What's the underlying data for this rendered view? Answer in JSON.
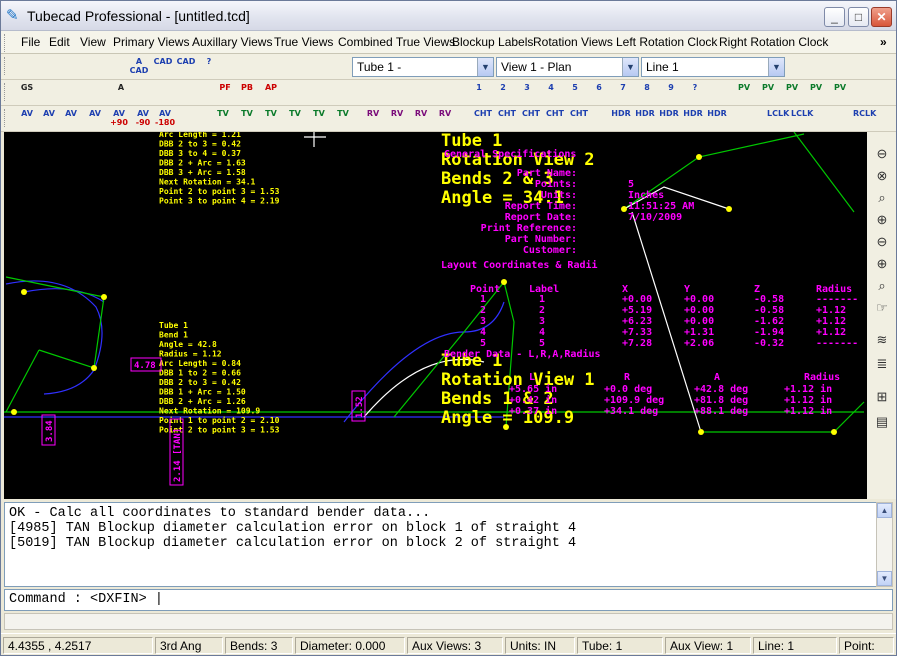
{
  "window": {
    "title": "Tubecad Professional  - [untitled.tcd]",
    "min": "_",
    "max": "□",
    "close": "✕"
  },
  "menu": [
    "File",
    "Edit",
    "View",
    "Primary Views",
    "Auxillary Views",
    "True Views",
    "Combined True Views",
    "Blockup Labels",
    "Rotation Views",
    "Left Rotation Clock",
    "Right Rotation Clock"
  ],
  "menu_more": "»",
  "toolbar1": {
    "combos": {
      "tube": "Tube 1 -",
      "view": "View 1 - Plan",
      "line": "Line 1"
    },
    "icons": [
      "new-file-icon",
      "new-icon",
      "open-icon",
      "save-icon",
      "print-icon",
      "cad-a-icon",
      "cad-icon",
      "cad-b-icon",
      "help-icon",
      "zoom-page-icon",
      "zoom-page-2-icon",
      "zoom-page-3-icon",
      "zoom-page-4-icon",
      "zoom-page-5-icon",
      "zoom-page-6-icon"
    ],
    "icon_labels": [
      "",
      "",
      "",
      "",
      "",
      "A CAD",
      "CAD",
      "CAD",
      "?",
      "",
      "",
      "",
      "",
      "",
      ""
    ]
  },
  "toolbar2": {
    "labels": [
      "GS",
      "",
      "",
      "",
      "A",
      "",
      "",
      "",
      "PF",
      "PB",
      "AP",
      "",
      "",
      "",
      "",
      "",
      "",
      "",
      "1",
      "2",
      "3",
      "4",
      "5",
      "6",
      "7",
      "8",
      "9",
      "?",
      "PV",
      "PV",
      "PV",
      "PV",
      "PV"
    ]
  },
  "toolbar3": {
    "labels": [
      "AV",
      "AV",
      "AV",
      "AV",
      "AV",
      "AV",
      "AV",
      "TV",
      "TV",
      "TV",
      "TV",
      "TV",
      "TV",
      "RV",
      "RV",
      "RV",
      "RV",
      "CHT",
      "CHT",
      "CHT",
      "CHT",
      "CHT",
      "HDR",
      "HDR",
      "HDR",
      "HDR",
      "HDR",
      "LCLK",
      "LCLK",
      "RCLK"
    ],
    "sub": [
      "",
      "",
      "",
      "",
      "+90",
      "-90",
      "-180",
      "",
      "",
      "",
      "",
      "",
      "",
      "",
      "",
      "",
      "",
      "",
      "",
      "",
      "",
      "",
      "",
      "",
      "",
      "",
      "",
      "",
      "",
      ""
    ]
  },
  "canvas": {
    "yellow_block_top": [
      "Arc Length = 1.21",
      "DBB 2 to 3 = 0.42",
      "DBB 3 to 4 = 0.37",
      "DBB 2 + Arc = 1.63",
      "DBB 3 + Arc = 1.58",
      "Next Rotation = 34.1",
      "Point 2 to point 3 = 1.53",
      "Point 3 to point 4 = 2.19"
    ],
    "yellow_block_mid": [
      "Tube 1",
      "Bend 1",
      "Angle = 42.8",
      "Radius = 1.12",
      "Arc Length = 0.84",
      "DBB 1 to 2 = 0.66",
      "DBB 2 to 3 = 0.42",
      "DBB 1 + Arc = 1.50",
      "DBB 2 + Arc = 1.26",
      "Next Rotation = 109.9",
      "Point 1 to point 2 = 2.10",
      "Point 2 to point 3 = 1.53"
    ],
    "view2_header": [
      "Tube 1",
      "Rotation View 2",
      "Bends 2 & 3",
      "Angle = 34.1"
    ],
    "view1_header": [
      "Tube 1",
      "Rotation View 1",
      "Bends 1 & 2",
      "Angle = 109.9"
    ],
    "spec": {
      "title": "General Specifications",
      "rows": [
        [
          "Part Name:",
          ""
        ],
        [
          "Points:",
          "5"
        ],
        [
          "Units:",
          "Inches"
        ],
        [
          "Report Time:",
          "11:51:25 AM"
        ],
        [
          "Report Date:",
          "7/10/2009"
        ],
        [
          "Print Reference:",
          ""
        ],
        [
          "Part Number:",
          ""
        ],
        [
          "Customer:",
          ""
        ]
      ],
      "footer": "Layout Coordinates & Radii"
    },
    "coord_header": [
      "Point",
      "Label",
      "X",
      "Y",
      "Z",
      "Radius"
    ],
    "coords": [
      [
        "1",
        "1",
        "+0.00",
        "+0.00",
        "-0.58",
        "-------"
      ],
      [
        "2",
        "2",
        "+5.19",
        "+0.00",
        "-0.58",
        "+1.12"
      ],
      [
        "3",
        "3",
        "+6.23",
        "+0.00",
        "-1.62",
        "+1.12"
      ],
      [
        "4",
        "4",
        "+7.33",
        "+1.31",
        "-1.94",
        "+1.12"
      ],
      [
        "5",
        "5",
        "+7.28",
        "+2.06",
        "-0.32",
        "-------"
      ]
    ],
    "bender_title": "Bender Data - L,R,A,Radius",
    "bender_header": [
      "L",
      "R",
      "A",
      "Radius"
    ],
    "bender": [
      [
        "+5.65 in",
        "+0.0 deg",
        "+42.8 deg",
        "+1.12 in"
      ],
      [
        "+0.42 in",
        "+109.9 deg",
        "+81.8 deg",
        "+1.12 in"
      ],
      [
        "+0.37 in",
        "+34.1 deg",
        "+88.1 deg",
        "+1.12 in"
      ]
    ],
    "dims": [
      "4.78",
      "3.84",
      "2.14 [TAN]",
      "1.52"
    ]
  },
  "output": {
    "lines": [
      "OK - Calc all coordinates to standard bender data...",
      "[4985] TAN Blockup diameter calculation error on block 1 of straight 4",
      "[5019] TAN Blockup diameter calculation error on block 2 of straight 4"
    ]
  },
  "command": {
    "label": "Command : <DXFIN>",
    "cursor": "|"
  },
  "status": [
    "4.4355 , 4.2517",
    "3rd Ang",
    "Bends: 3",
    "Diameter: 0.000",
    "Aux Views: 3",
    "Units: IN",
    "Tube: 1",
    "Aux View: 1",
    "Line: 1",
    "Point:"
  ],
  "colors": {
    "yellow": "#ffff00",
    "magenta": "#ff00ff",
    "green": "#00c800",
    "blue": "#3030ff",
    "canvas": "#000000"
  }
}
